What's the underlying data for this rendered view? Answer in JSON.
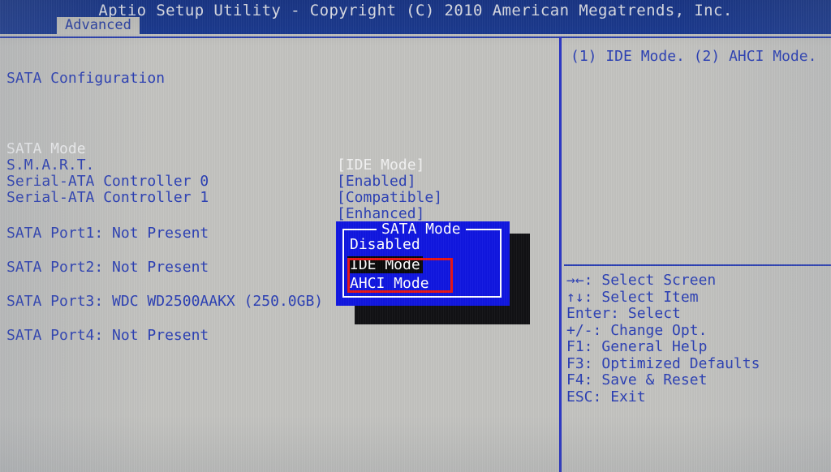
{
  "header": {
    "title": "Aptio Setup Utility - Copyright (C) 2010 American Megatrends, Inc.",
    "tabs": [
      {
        "label": "Advanced",
        "active": true
      }
    ]
  },
  "left_pane": {
    "section_title": "SATA Configuration",
    "settings": [
      {
        "label": "SATA Mode",
        "value": "[IDE Mode]",
        "selected": true
      },
      {
        "label": "S.M.A.R.T.",
        "value": "[Enabled]",
        "selected": false
      },
      {
        "label": "Serial-ATA Controller 0",
        "value": "[Compatible]",
        "selected": false
      },
      {
        "label": "Serial-ATA Controller 1",
        "value": "[Enhanced]",
        "selected": false
      }
    ],
    "ports": [
      {
        "label": "SATA Port1: Not Present"
      },
      {
        "label": "SATA Port2: Not Present"
      },
      {
        "label": "SATA Port3: WDC WD2500AAKX (250.0GB)"
      },
      {
        "label": "SATA Port4: Not Present"
      }
    ]
  },
  "right_pane": {
    "help_text": "(1) IDE Mode. (2) AHCI Mode.",
    "keys": [
      {
        "key": "→←:",
        "action": "Select Screen"
      },
      {
        "key": "↑↓:",
        "action": "Select Item"
      },
      {
        "key": "Enter:",
        "action": "Select"
      },
      {
        "key": "+/-:",
        "action": "Change Opt."
      },
      {
        "key": "F1:",
        "action": "General Help"
      },
      {
        "key": "F3:",
        "action": "Optimized Defaults"
      },
      {
        "key": "F4:",
        "action": "Save & Reset"
      },
      {
        "key": "ESC:",
        "action": "Exit"
      }
    ]
  },
  "popup": {
    "title": "SATA Mode",
    "options": [
      {
        "label": "Disabled",
        "selected": false
      },
      {
        "label": "IDE Mode",
        "selected": true
      },
      {
        "label": "AHCI Mode",
        "selected": false
      }
    ]
  },
  "annotation": {
    "type": "rectangle",
    "color": "#e81414"
  },
  "colors": {
    "header_blue": "#1c3b92",
    "background_gray": "#c3c3c0",
    "text_blue": "#2b3fb4",
    "text_white": "#f2f2f2",
    "popup_blue": "#1016e0",
    "highlight_black": "#0a0a0a",
    "annotation_red": "#e81414"
  }
}
